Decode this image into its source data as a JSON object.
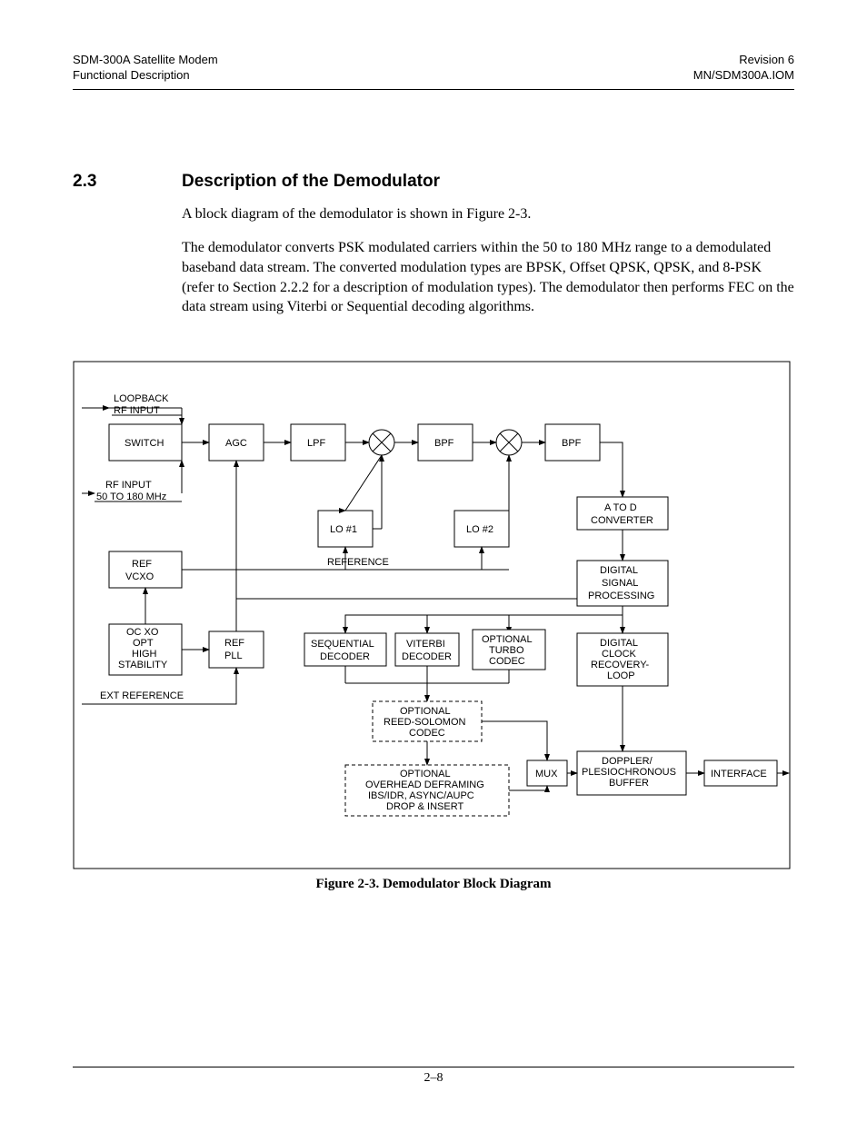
{
  "header": {
    "left_line1": "SDM-300A Satellite Modem",
    "left_line2": "Functional Description",
    "right_line1": "Revision 6",
    "right_line2": "MN/SDM300A.IOM"
  },
  "section": {
    "number": "2.3",
    "title": "Description of the Demodulator"
  },
  "para1": "A block diagram of the demodulator is shown in Figure 2-3.",
  "para2": "The demodulator converts PSK modulated carriers within the 50 to 180 MHz range to a demodulated baseband data stream. The converted modulation types are BPSK, Offset QPSK, QPSK, and 8-PSK (refer to Section 2.2.2 for a description of modulation types). The demodulator then performs FEC on the data stream using Viterbi or Sequential decoding algorithms.",
  "diagram": {
    "caption": "Figure 2-3.  Demodulator Block Diagram",
    "labels": {
      "loopback1": "LOOPBACK",
      "loopback2": "RF INPUT",
      "rfin1": "RF INPUT",
      "rfin2": "50 TO 180 MHz",
      "extref": "EXT REFERENCE",
      "reference": "REFERENCE"
    },
    "boxes": {
      "switch": "SWITCH",
      "agc": "AGC",
      "lpf": "LPF",
      "bpf1": "BPF",
      "bpf2": "BPF",
      "lo1": "LO #1",
      "lo2": "LO #2",
      "refvcxo_a": "REF",
      "refvcxo_b": "VCXO",
      "refpll_a": "REF",
      "refpll_b": "PLL",
      "ocxo1": "OC XO",
      "ocxo2": "OPT",
      "ocxo3": "HIGH",
      "ocxo4": "STABILITY",
      "atod1": "A TO D",
      "atod2": "CONVERTER",
      "dsp1": "DIGITAL",
      "dsp2": "SIGNAL",
      "dsp3": "PROCESSING",
      "dcrl1": "DIGITAL",
      "dcrl2": "CLOCK",
      "dcrl3": "RECOVERY-",
      "dcrl4": "LOOP",
      "seq1": "SEQUENTIAL",
      "seq2": "DECODER",
      "vit1": "VITERBI",
      "vit2": "DECODER",
      "turbo1": "OPTIONAL",
      "turbo2": "TURBO",
      "turbo3": "CODEC",
      "rs1": "OPTIONAL",
      "rs2": "REED-SOLOMON",
      "rs3": "CODEC",
      "ovh1": "OPTIONAL",
      "ovh2": "OVERHEAD DEFRAMING",
      "ovh3": "IBS/IDR, ASYNC/AUPC",
      "ovh4": "DROP & INSERT",
      "mux": "MUX",
      "dop1": "DOPPLER/",
      "dop2": "PLESIOCHRONOUS",
      "dop3": "BUFFER",
      "iface": "INTERFACE"
    }
  },
  "page_number": "2–8"
}
